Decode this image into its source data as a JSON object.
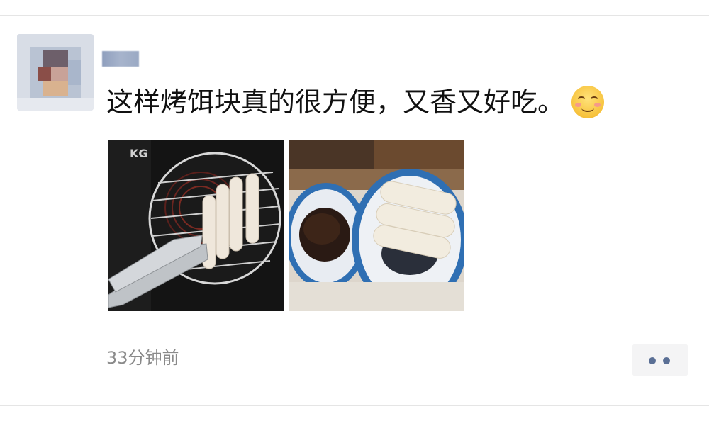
{
  "post": {
    "text": "这样烤饵块真的很方便，又香又好吃。",
    "emoji": "smiling-blush-emoji",
    "timestamp": "33分钟前"
  },
  "photos": [
    {
      "name": "photo-grilling-erkuai"
    },
    {
      "name": "photo-erkuai-with-sauce"
    }
  ],
  "actions": {
    "more_icon": "more-dots-icon"
  },
  "colors": {
    "text": "#111111",
    "timestamp": "#8a8a8a",
    "action_dots": "#5a6f95",
    "action_bg": "#f4f4f5"
  }
}
